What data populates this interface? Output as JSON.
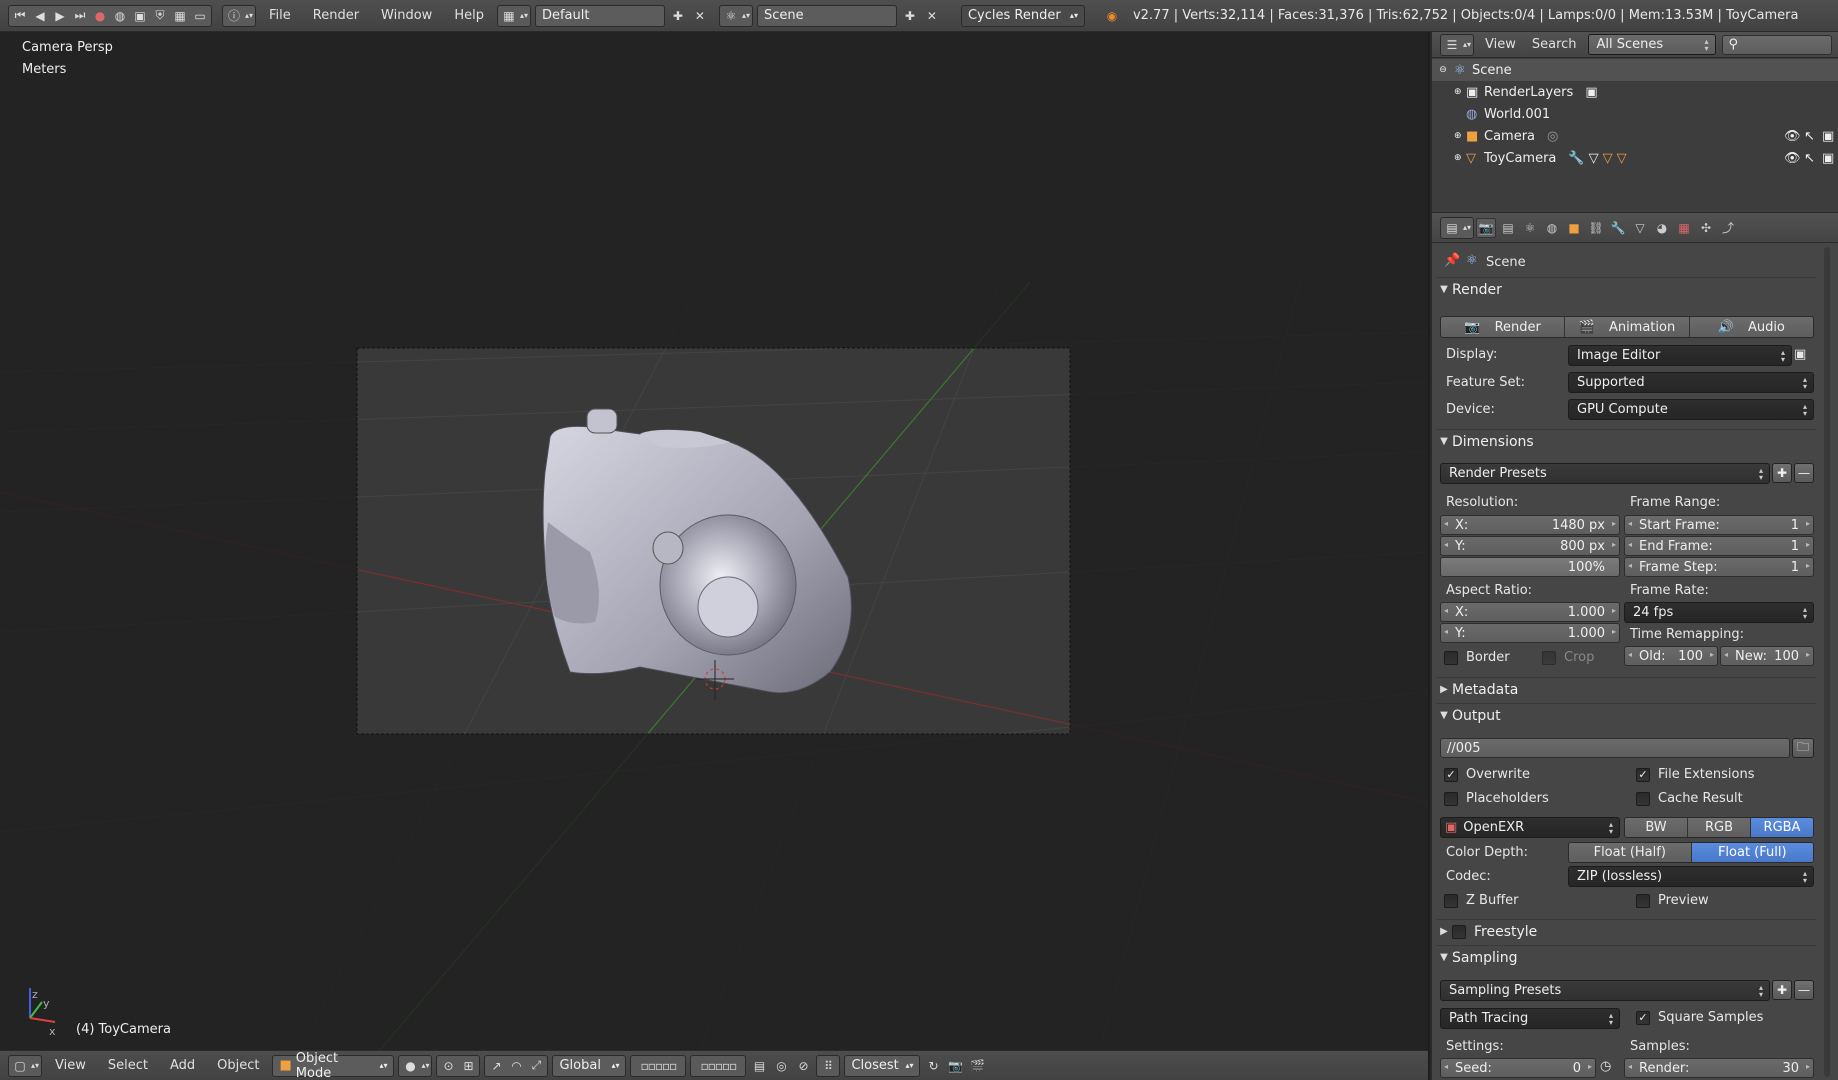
{
  "topbar": {
    "menu": [
      "File",
      "Render",
      "Window",
      "Help"
    ],
    "layout": "Default",
    "scene": "Scene",
    "engine": "Cycles Render",
    "stats": "v2.77 | Verts:32,114 | Faces:31,376 | Tris:62,752 | Objects:0/4 | Lamps:0/0 | Mem:13.53M | ToyCamera"
  },
  "viewport": {
    "view_name": "Camera Persp",
    "units": "Meters",
    "selected_object": "(4) ToyCamera",
    "axis_labels": {
      "z": "z",
      "y": "y",
      "x": "x"
    }
  },
  "bottombar": {
    "menu": [
      "View",
      "Select",
      "Add",
      "Object"
    ],
    "mode": "Object Mode",
    "orientation": "Global",
    "snap": "Closest"
  },
  "outliner": {
    "menu": [
      "View",
      "Search"
    ],
    "filter": "All Scenes",
    "items": [
      "Scene",
      "RenderLayers",
      "World.001",
      "Camera",
      "ToyCamera"
    ]
  },
  "props": {
    "context": "Scene",
    "render": {
      "title": "Render",
      "buttons": [
        "Render",
        "Animation",
        "Audio"
      ],
      "display_label": "Display:",
      "display": "Image Editor",
      "feature_label": "Feature Set:",
      "feature": "Supported",
      "device_label": "Device:",
      "device": "GPU Compute"
    },
    "dimensions": {
      "title": "Dimensions",
      "presets": "Render Presets",
      "resolution_label": "Resolution:",
      "res_x_key": "X:",
      "res_x": "1480 px",
      "res_y_key": "Y:",
      "res_y": "800 px",
      "res_pct": "100%",
      "frame_range_label": "Frame Range:",
      "start_key": "Start Frame:",
      "start": "1",
      "end_key": "End Frame:",
      "end": "1",
      "step_key": "Frame Step:",
      "step": "1",
      "aspect_label": "Aspect Ratio:",
      "asp_x_key": "X:",
      "asp_x": "1.000",
      "asp_y_key": "Y:",
      "asp_y": "1.000",
      "frame_rate_label": "Frame Rate:",
      "fps": "24 fps",
      "remap_label": "Time Remapping:",
      "old_key": "Old:",
      "old": "100",
      "new_key": "New:",
      "new": "100",
      "border": "Border",
      "crop": "Crop"
    },
    "metadata": {
      "title": "Metadata"
    },
    "output": {
      "title": "Output",
      "path": "//005",
      "overwrite": "Overwrite",
      "file_ext": "File Extensions",
      "placeholders": "Placeholders",
      "cache": "Cache Result",
      "format": "OpenEXR",
      "channels": [
        "BW",
        "RGB",
        "RGBA"
      ],
      "depth_label": "Color Depth:",
      "depth": [
        "Float (Half)",
        "Float (Full)"
      ],
      "codec_label": "Codec:",
      "codec": "ZIP (lossless)",
      "zbuffer": "Z Buffer",
      "preview": "Preview"
    },
    "freestyle": {
      "title": "Freestyle"
    },
    "sampling": {
      "title": "Sampling",
      "presets": "Sampling Presets",
      "integrator": "Path Tracing",
      "square": "Square Samples",
      "settings_label": "Settings:",
      "seed_key": "Seed:",
      "seed": "0",
      "samples_label": "Samples:",
      "render_key": "Render:",
      "render": "30"
    }
  },
  "colors": {
    "accent": "#5a8ce0",
    "viewport_bg": "#393939",
    "panel_bg": "#464646"
  }
}
